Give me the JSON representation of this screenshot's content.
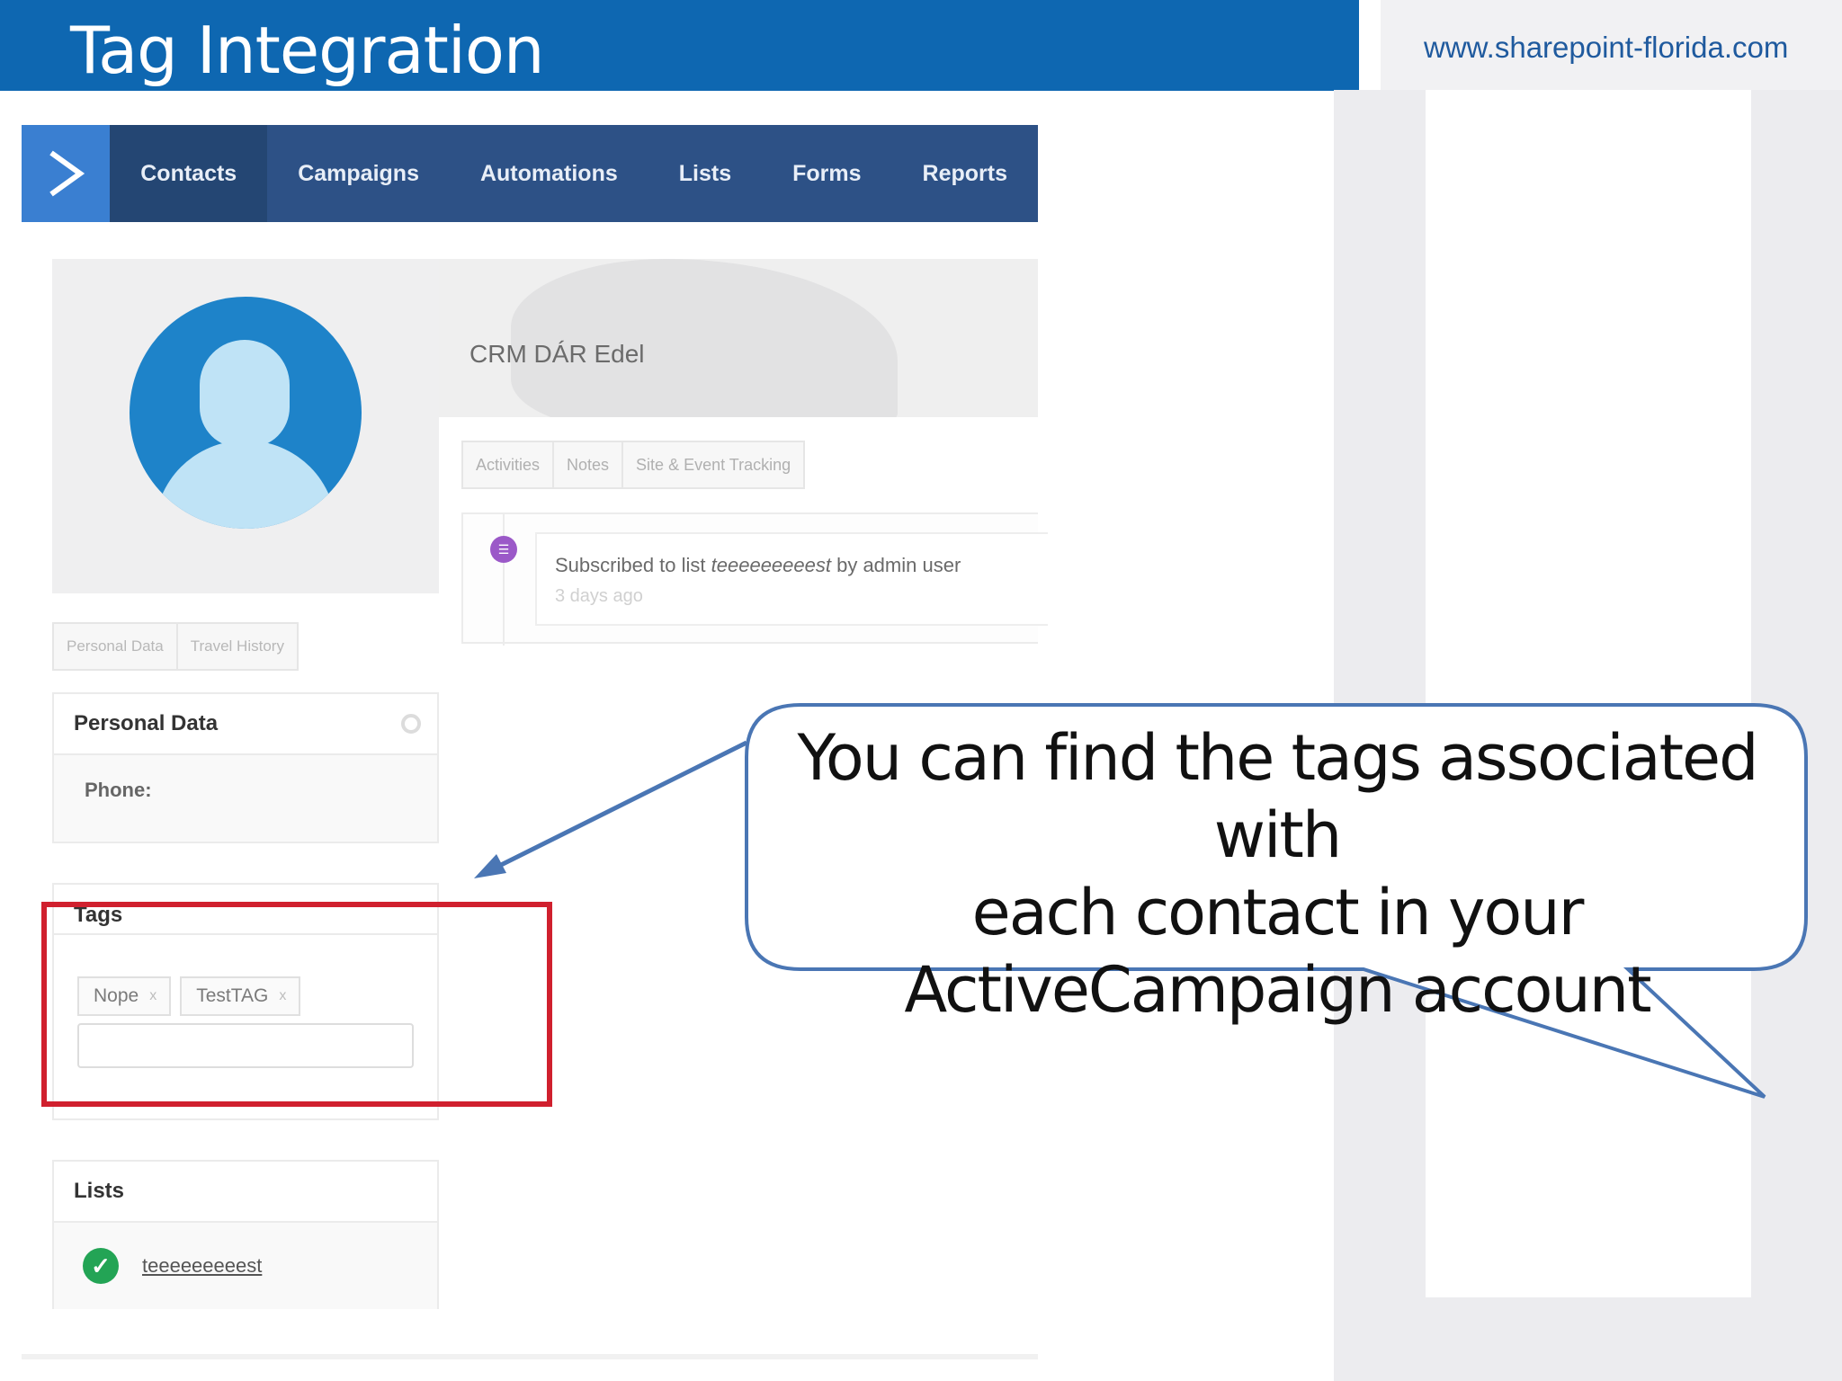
{
  "slide": {
    "title": "Tag Integration",
    "site_url": "www.sharepoint-florida.com"
  },
  "app_nav": {
    "logo_icon": "chevron-right-icon",
    "items": [
      "Contacts",
      "Campaigns",
      "Automations",
      "Lists",
      "Forms",
      "Reports"
    ],
    "active": "Contacts"
  },
  "contact": {
    "name": "CRM DÁR Edel",
    "avatar_icon": "user-silhouette-icon"
  },
  "activity_tabs": [
    "Activities",
    "Notes",
    "Site & Event Tracking"
  ],
  "activity": {
    "prefix": "Subscribed to list ",
    "list_name": "teeeeeeeeest",
    "suffix": " by admin user",
    "time": "3 days ago"
  },
  "left_tabs": [
    "Personal Data",
    "Travel History"
  ],
  "personal_data": {
    "heading": "Personal Data",
    "phone_label": "Phone:"
  },
  "tags": {
    "heading": "Tags",
    "items": [
      "Nope",
      "TestTAG"
    ],
    "remove_glyph": "x",
    "input_value": ""
  },
  "lists": {
    "heading": "Lists",
    "items": [
      "teeeeeeeeest"
    ]
  },
  "callout": {
    "lines": [
      "You can find the tags associated with",
      "each contact in your",
      "ActiveCampaign account"
    ]
  },
  "colors": {
    "title_bar": "#0e67b1",
    "nav_bg": "#2d5186",
    "highlight": "#d0202e",
    "callout_border": "#4a76b4"
  }
}
